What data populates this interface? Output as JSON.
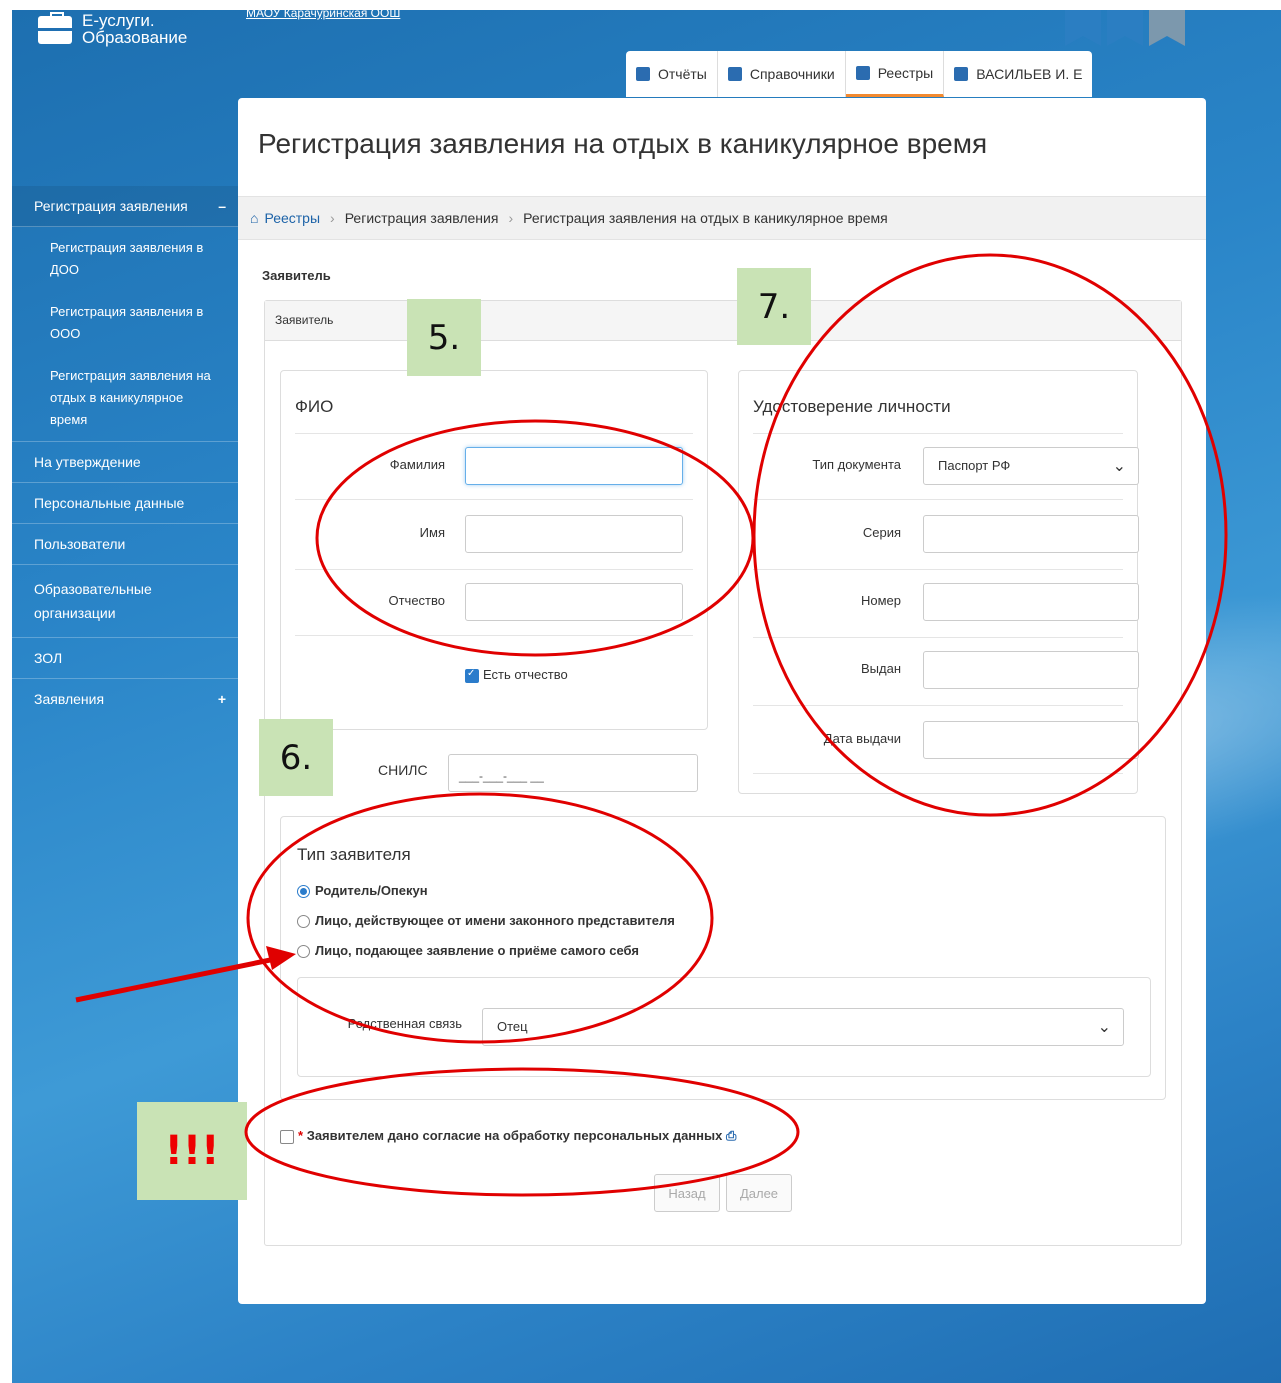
{
  "header": {
    "logo_line1": "Е-услуги.",
    "logo_line2": "Образование",
    "org_link": "МАОУ  Карачуринская ООШ",
    "tabs": [
      {
        "label": "Отчёты",
        "icon": "report-icon"
      },
      {
        "label": "Справочники",
        "icon": "book-icon"
      },
      {
        "label": "Реестры",
        "icon": "registry-icon"
      },
      {
        "label": "ВАСИЛЬЕВ И. Е",
        "icon": "user-icon"
      }
    ]
  },
  "sidebar": {
    "items": [
      {
        "label": "Регистрация заявления",
        "sign": "–"
      },
      {
        "label": "Регистрация заявления в ДОО"
      },
      {
        "label": "Регистрация заявления в ООО"
      },
      {
        "label": "Регистрация заявления на отдых в каникулярное время"
      },
      {
        "label": "На утверждение"
      },
      {
        "label": "Персональные данные"
      },
      {
        "label": "Пользователи"
      },
      {
        "label": "Образовательные организации"
      },
      {
        "label": "ЗОЛ"
      },
      {
        "label": "Заявления",
        "sign": "+"
      }
    ]
  },
  "page": {
    "title": "Регистрация заявления на отдых в каникулярное время",
    "breadcrumb": [
      "Реестры",
      "Регистрация заявления",
      "Регистрация заявления на отдых в каникулярное время"
    ],
    "section_title": "Заявитель",
    "card_header": "Заявитель"
  },
  "fio": {
    "title": "ФИО",
    "surname_label": "Фамилия",
    "name_label": "Имя",
    "patronymic_label": "Отчество",
    "has_patronymic_label": "Есть отчество",
    "has_patronymic": true
  },
  "snils": {
    "label": "СНИЛС",
    "placeholder": "___-___-___ __"
  },
  "identity": {
    "title": "Удостоверение личности",
    "doc_type_label": "Тип документа",
    "doc_type_value": "Паспорт РФ",
    "series_label": "Серия",
    "number_label": "Номер",
    "issued_label": "Выдан",
    "issue_date_label": "Дата выдачи"
  },
  "applicant_type": {
    "title": "Тип заявителя",
    "options": [
      {
        "label": "Родитель/Опекун",
        "selected": true
      },
      {
        "label": "Лицо, действующее от имени законного представителя",
        "selected": false
      },
      {
        "label": "Лицо, подающее заявление о приёме самого себя",
        "selected": false
      }
    ],
    "relation_label": "Родственная связь",
    "relation_value": "Отец"
  },
  "consent": {
    "required_mark": "*",
    "label": "Заявителем дано согласие на обработку персональных данных",
    "checked": false
  },
  "buttons": {
    "back": "Назад",
    "next": "Далее"
  },
  "annotations": {
    "note_5": "5.",
    "note_6": "6.",
    "note_7": "7.",
    "note_excl": "!!!",
    "color": "#e00000",
    "note_bg": "#c9e3b5"
  }
}
